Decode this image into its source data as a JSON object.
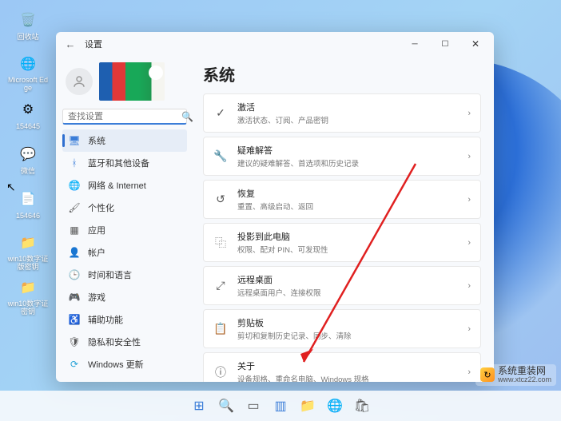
{
  "desktop": {
    "icons": [
      {
        "name": "recycle-bin",
        "label": "回收站",
        "glyph": "🗑️"
      },
      {
        "name": "edge",
        "label": "Microsoft Edge",
        "glyph": "🌐"
      },
      {
        "name": "file-154645",
        "label": "154645",
        "glyph": "⚙"
      },
      {
        "name": "wechat",
        "label": "微信",
        "glyph": "💬"
      },
      {
        "name": "file-154646",
        "label": "154646",
        "glyph": "📄"
      },
      {
        "name": "folder-win10a",
        "label": "win10数字证版密钥",
        "glyph": "📁"
      },
      {
        "name": "folder-win10b",
        "label": "win10数字证密钥",
        "glyph": "📁"
      }
    ]
  },
  "window": {
    "title": "设置",
    "search_placeholder": "查找设置",
    "heading": "系统"
  },
  "nav": [
    {
      "id": "system",
      "label": "系统",
      "color": "#3B7DD8",
      "glyph": "🖥",
      "selected": true
    },
    {
      "id": "bluetooth",
      "label": "蓝牙和其他设备",
      "color": "#3B7DD8",
      "glyph": "ᚼ"
    },
    {
      "id": "network",
      "label": "网络 & Internet",
      "color": "#555",
      "glyph": "🌐"
    },
    {
      "id": "personalization",
      "label": "个性化",
      "color": "#555",
      "glyph": "🖌"
    },
    {
      "id": "apps",
      "label": "应用",
      "color": "#555",
      "glyph": "▦"
    },
    {
      "id": "accounts",
      "label": "帐户",
      "color": "#555",
      "glyph": "👤"
    },
    {
      "id": "time",
      "label": "时间和语言",
      "color": "#555",
      "glyph": "🕒"
    },
    {
      "id": "gaming",
      "label": "游戏",
      "color": "#555",
      "glyph": "🎮"
    },
    {
      "id": "accessibility",
      "label": "辅助功能",
      "color": "#555",
      "glyph": "♿"
    },
    {
      "id": "privacy",
      "label": "隐私和安全性",
      "color": "#555",
      "glyph": "🛡"
    },
    {
      "id": "update",
      "label": "Windows 更新",
      "color": "#2CA5D8",
      "glyph": "⟳"
    }
  ],
  "cards": [
    {
      "id": "activation",
      "icon": "✓",
      "title": "激活",
      "sub": "激活状态、订阅、产品密钥"
    },
    {
      "id": "troubleshoot",
      "icon": "🔧",
      "title": "疑难解答",
      "sub": "建议的疑难解答、首选项和历史记录"
    },
    {
      "id": "recovery",
      "icon": "↺",
      "title": "恢复",
      "sub": "重置、高级启动、返回"
    },
    {
      "id": "projecting",
      "icon": "⿻",
      "title": "投影到此电脑",
      "sub": "权限、配对 PIN、可发现性"
    },
    {
      "id": "remote",
      "icon": "⤢",
      "title": "远程桌面",
      "sub": "远程桌面用户、连接权限"
    },
    {
      "id": "clipboard",
      "icon": "📋",
      "title": "剪贴板",
      "sub": "剪切和复制历史记录、同步、清除"
    },
    {
      "id": "about",
      "icon": "ⓘ",
      "title": "关于",
      "sub": "设备规格、重命名电脑、Windows 规格"
    }
  ],
  "watermark": {
    "title": "系统重装网",
    "url": "www.xtcz22.com"
  },
  "taskbar": [
    {
      "id": "start",
      "glyph": "⊞",
      "color": "#3B7DD8"
    },
    {
      "id": "search",
      "glyph": "🔍",
      "color": "#555"
    },
    {
      "id": "taskview",
      "glyph": "▭",
      "color": "#555"
    },
    {
      "id": "widgets",
      "glyph": "▥",
      "color": "#3B7DD8"
    },
    {
      "id": "explorer",
      "glyph": "📁",
      "color": "#F5C048"
    },
    {
      "id": "edge",
      "glyph": "🌐",
      "color": "#3B7DD8"
    },
    {
      "id": "store",
      "glyph": "🛍",
      "color": "#555"
    }
  ]
}
